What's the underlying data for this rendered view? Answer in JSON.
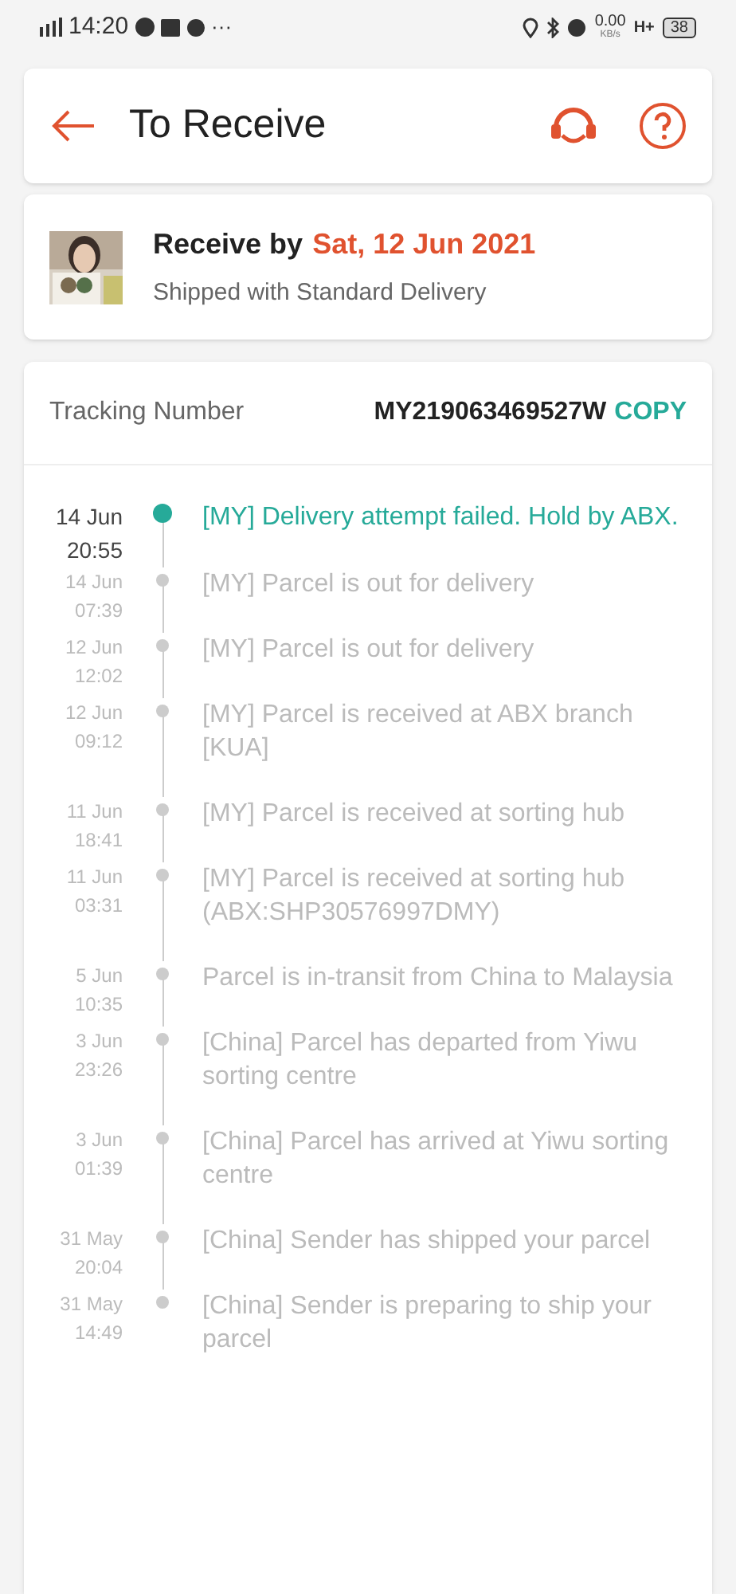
{
  "status_bar": {
    "time": "14:20",
    "more": "···",
    "speed": "0.00",
    "speed_unit": "KB/s",
    "network": "H+",
    "battery": "38"
  },
  "header": {
    "title": "To Receive"
  },
  "delivery": {
    "label": "Receive by",
    "date": "Sat, 12 Jun 2021",
    "method": "Shipped with Standard Delivery"
  },
  "tracking": {
    "label": "Tracking Number",
    "number": "MY219063469527W",
    "copy": "COPY"
  },
  "events": [
    {
      "date": "14 Jun",
      "time": "20:55",
      "text": "[MY] Delivery attempt failed. Hold by ABX.",
      "current": true
    },
    {
      "date": "14 Jun",
      "time": "07:39",
      "text": "[MY] Parcel is out for delivery",
      "current": false
    },
    {
      "date": "12 Jun",
      "time": "12:02",
      "text": "[MY] Parcel is out for delivery",
      "current": false
    },
    {
      "date": "12 Jun",
      "time": "09:12",
      "text": "[MY] Parcel is received at ABX branch [KUA]",
      "current": false
    },
    {
      "date": "11 Jun",
      "time": "18:41",
      "text": "[MY] Parcel is received at sorting hub",
      "current": false
    },
    {
      "date": "11 Jun",
      "time": "03:31",
      "text": "[MY] Parcel is received at sorting hub (ABX:SHP30576997DMY)",
      "current": false
    },
    {
      "date": "5 Jun",
      "time": "10:35",
      "text": "Parcel is in-transit from China to Malaysia",
      "current": false
    },
    {
      "date": "3 Jun",
      "time": "23:26",
      "text": "[China] Parcel has departed from Yiwu sorting centre",
      "current": false
    },
    {
      "date": "3 Jun",
      "time": "01:39",
      "text": "[China] Parcel has arrived at Yiwu sorting centre",
      "current": false
    },
    {
      "date": "31 May",
      "time": "20:04",
      "text": "[China] Sender has shipped your parcel",
      "current": false
    },
    {
      "date": "31 May",
      "time": "14:49",
      "text": "[China] Sender is preparing to ship your parcel",
      "current": false
    }
  ]
}
